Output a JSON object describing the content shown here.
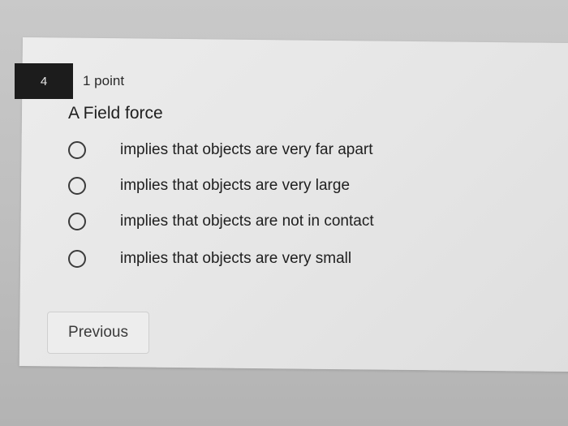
{
  "question": {
    "number": "4",
    "points": "1 point",
    "text": "A Field force",
    "options": [
      {
        "label": "implies that objects are very far apart",
        "selected": false
      },
      {
        "label": "implies that objects are very large",
        "selected": false
      },
      {
        "label": "implies that objects are not in contact",
        "selected": false
      },
      {
        "label": "implies that objects are very small",
        "selected": false
      }
    ]
  },
  "nav": {
    "previous_label": "Previous"
  }
}
